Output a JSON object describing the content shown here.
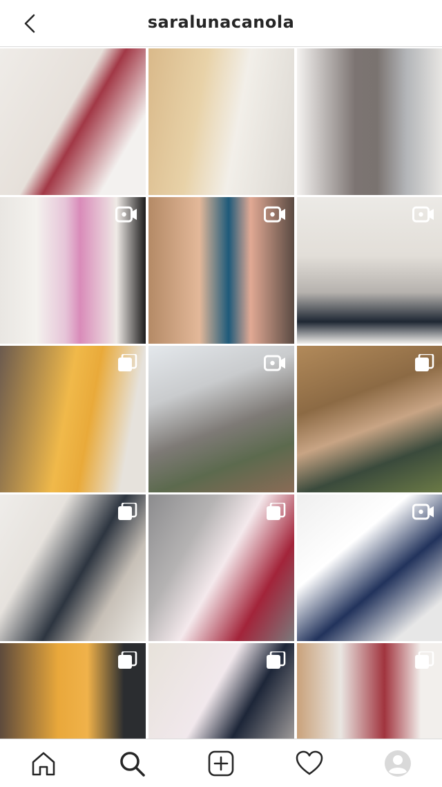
{
  "header": {
    "title": "saralunacanola",
    "back_icon": "chevron-left-icon"
  },
  "grid": {
    "tiles": [
      {
        "tone": "t0",
        "badge": "none"
      },
      {
        "tone": "t1",
        "badge": "none"
      },
      {
        "tone": "t2",
        "badge": "none"
      },
      {
        "tone": "t3",
        "badge": "igtv-icon"
      },
      {
        "tone": "t4",
        "badge": "igtv-icon"
      },
      {
        "tone": "t5",
        "badge": "igtv-icon"
      },
      {
        "tone": "t6",
        "badge": "carousel-icon"
      },
      {
        "tone": "t7",
        "badge": "igtv-icon"
      },
      {
        "tone": "t8",
        "badge": "carousel-icon"
      },
      {
        "tone": "t9",
        "badge": "carousel-icon"
      },
      {
        "tone": "t10",
        "badge": "carousel-icon"
      },
      {
        "tone": "t11",
        "badge": "igtv-icon"
      },
      {
        "tone": "t12",
        "badge": "carousel-icon"
      },
      {
        "tone": "t13",
        "badge": "carousel-icon"
      },
      {
        "tone": "t14",
        "badge": "carousel-icon"
      }
    ]
  },
  "bottom_nav": {
    "items": [
      {
        "icon": "home-icon"
      },
      {
        "icon": "search-icon",
        "active": true
      },
      {
        "icon": "new-post-icon"
      },
      {
        "icon": "heart-icon"
      },
      {
        "icon": "profile-avatar-icon"
      }
    ]
  },
  "colors": {
    "text": "#262626",
    "border": "#dbdbdb",
    "background": "#ffffff"
  }
}
